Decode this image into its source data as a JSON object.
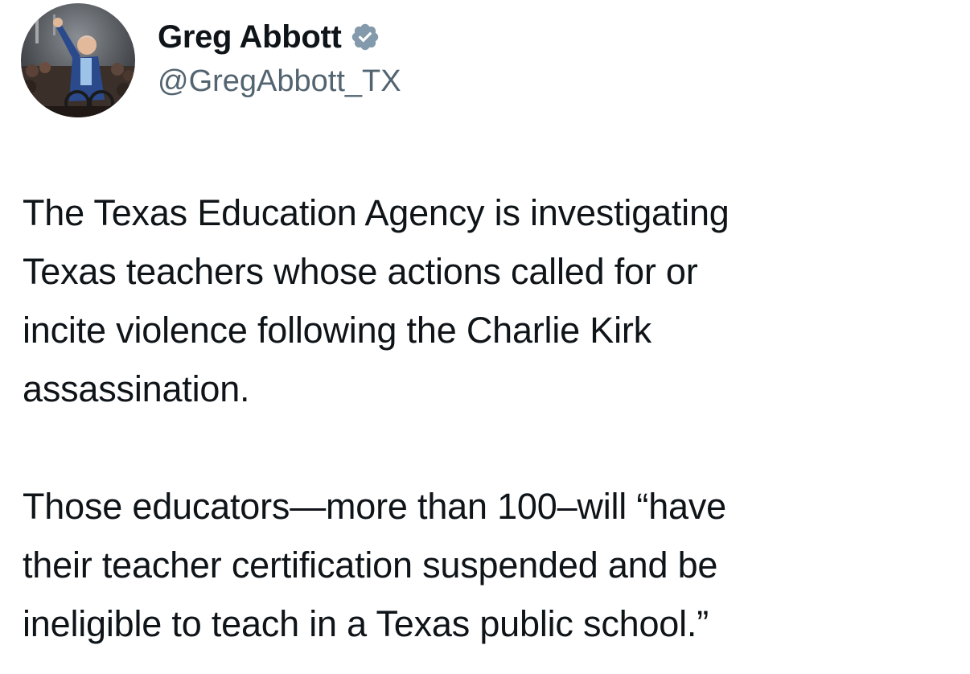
{
  "author": {
    "display_name": "Greg Abbott",
    "handle": "@GregAbbott_TX",
    "verified": true,
    "verified_icon": "verified-badge-icon",
    "verified_color": "#829aab"
  },
  "tweet": {
    "paragraphs": [
      {
        "lines": [
          "The Texas Education Agency is investigating",
          "Texas teachers whose actions called for or",
          "incite violence following the Charlie Kirk",
          "assassination."
        ]
      },
      {
        "lines": [
          "Those educators—more than 100–will “have",
          "their teacher certification suspended and be",
          "ineligible to teach in a Texas public school.”"
        ]
      }
    ]
  }
}
